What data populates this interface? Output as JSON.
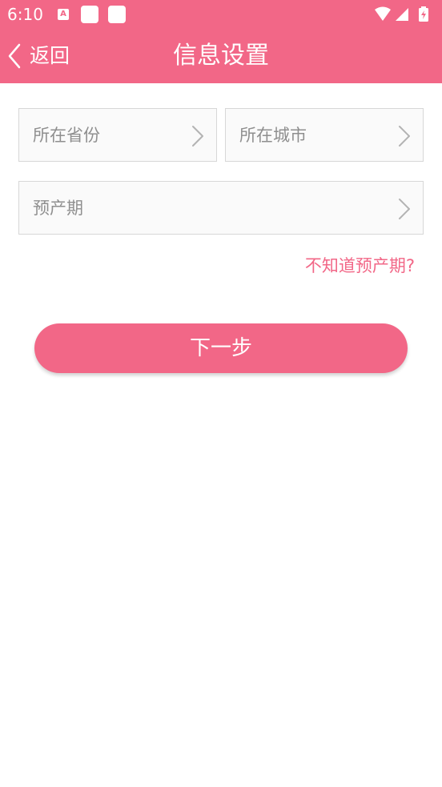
{
  "status_bar": {
    "time": "6:10",
    "icons": [
      "a-notification-icon",
      "app-icon",
      "app-icon",
      "wifi-icon",
      "cellular-signal-icon",
      "battery-charging-icon"
    ]
  },
  "nav": {
    "back_label": "返回",
    "title": "信息设置"
  },
  "form": {
    "province_placeholder": "所在省份",
    "city_placeholder": "所在城市",
    "due_date_placeholder": "预产期",
    "unknown_due_link": "不知道预产期?",
    "next_button": "下一步"
  },
  "colors": {
    "accent": "#f26787",
    "field_border": "#d7d7d7",
    "placeholder_text": "#8f8f8f"
  }
}
